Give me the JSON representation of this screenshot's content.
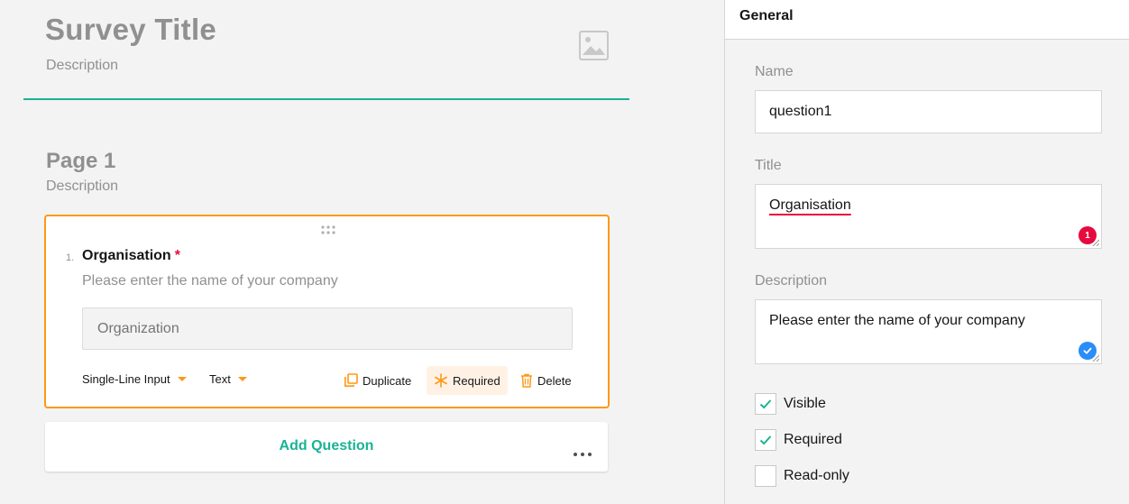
{
  "survey": {
    "title": "Survey Title",
    "description": "Description"
  },
  "page": {
    "title": "Page 1",
    "description": "Description"
  },
  "question": {
    "number": "1.",
    "title": "Organisation",
    "required_marker": "*",
    "description": "Please enter the name of your company",
    "placeholder": "Organization",
    "toolbar": {
      "type_label": "Single-Line Input",
      "input_type_label": "Text",
      "duplicate_label": "Duplicate",
      "required_label": "Required",
      "delete_label": "Delete"
    }
  },
  "add_question": {
    "label": "Add Question"
  },
  "property_grid": {
    "category": "General",
    "name": {
      "label": "Name",
      "value": "question1"
    },
    "title": {
      "label": "Title",
      "value": "Organisation",
      "error_count": "1"
    },
    "description": {
      "label": "Description",
      "value": "Please enter the name of your company"
    },
    "checkboxes": [
      {
        "label": "Visible",
        "checked": true
      },
      {
        "label": "Required",
        "checked": true
      },
      {
        "label": "Read-only",
        "checked": false
      }
    ]
  },
  "colors": {
    "accent": "#19b394",
    "selection": "#ff9814",
    "required": "#e60a3e",
    "info": "#2b8df7"
  },
  "icons": [
    "image-icon",
    "drag-handle-icon",
    "chevron-down-icon",
    "duplicate-icon",
    "required-icon",
    "delete-icon",
    "more-icon",
    "error-icon",
    "check-icon"
  ]
}
